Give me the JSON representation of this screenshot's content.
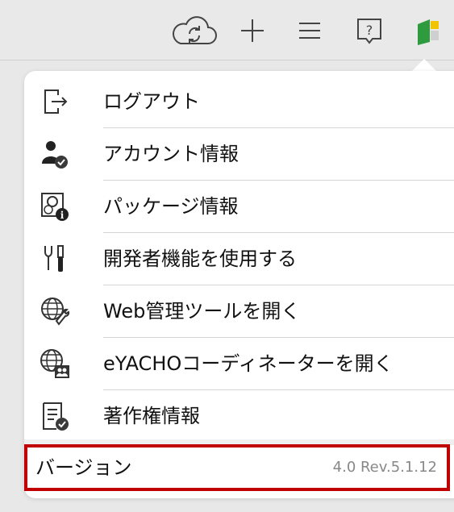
{
  "toolbar": {
    "icons": [
      "cloud-sync-icon",
      "plus-icon",
      "hamburger-menu-icon",
      "help-icon",
      "app-logo-icon"
    ],
    "help_glyph": "?"
  },
  "menu": {
    "items": [
      {
        "label": "ログアウト",
        "icon": "logout-icon"
      },
      {
        "label": "アカウント情報",
        "icon": "account-icon"
      },
      {
        "label": "パッケージ情報",
        "icon": "package-info-icon"
      },
      {
        "label": "開発者機能を使用する",
        "icon": "developer-tools-icon"
      },
      {
        "label": "Web管理ツールを開く",
        "icon": "web-admin-icon"
      },
      {
        "label": "eYACHOコーディネーターを開く",
        "icon": "coordinator-icon"
      },
      {
        "label": "著作権情報",
        "icon": "copyright-icon"
      }
    ],
    "version_label": "バージョン",
    "version_value": "4.0 Rev.5.1.12"
  },
  "colors": {
    "highlight_border": "#c00000",
    "logo_green": "#2e9b3e",
    "logo_yellow": "#f2c300"
  }
}
